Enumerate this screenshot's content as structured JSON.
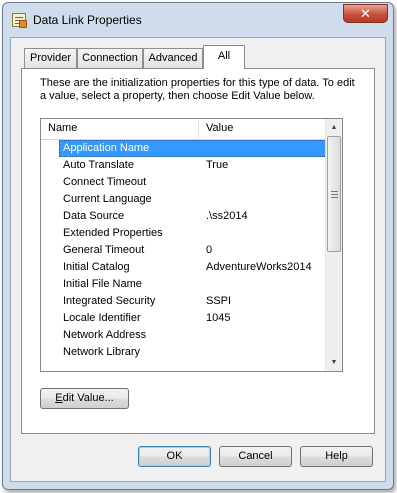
{
  "window": {
    "title": "Data Link Properties",
    "close_symbol": "✕"
  },
  "tabs": [
    {
      "label": "Provider",
      "active": false
    },
    {
      "label": "Connection",
      "active": false
    },
    {
      "label": "Advanced",
      "active": false
    },
    {
      "label": "All",
      "active": true
    }
  ],
  "description": "These are the initialization properties for this type of data. To edit a value, select a property, then choose Edit Value below.",
  "list": {
    "columns": {
      "name": "Name",
      "value": "Value"
    },
    "rows": [
      {
        "name": "Application Name",
        "value": "",
        "selected": true
      },
      {
        "name": "Auto Translate",
        "value": "True"
      },
      {
        "name": "Connect Timeout",
        "value": ""
      },
      {
        "name": "Current Language",
        "value": ""
      },
      {
        "name": "Data Source",
        "value": ".\\ss2014"
      },
      {
        "name": "Extended Properties",
        "value": ""
      },
      {
        "name": "General Timeout",
        "value": "0"
      },
      {
        "name": "Initial Catalog",
        "value": "AdventureWorks2014"
      },
      {
        "name": "Initial File Name",
        "value": ""
      },
      {
        "name": "Integrated Security",
        "value": "SSPI"
      },
      {
        "name": "Locale Identifier",
        "value": "1045"
      },
      {
        "name": "Network Address",
        "value": ""
      },
      {
        "name": "Network Library",
        "value": ""
      }
    ]
  },
  "buttons": {
    "edit_value_mnemonic": "E",
    "edit_value_rest": "dit Value...",
    "ok": "OK",
    "cancel": "Cancel",
    "help": "Help"
  },
  "colors": {
    "selection": "#3399ff",
    "dialog_bg": "#f0f0f0",
    "frame": "#cfdcec"
  },
  "icons": {
    "app": "data-link-icon",
    "close": "close-icon",
    "scroll_up": "scroll-up-arrow-icon",
    "scroll_down": "scroll-down-arrow-icon"
  }
}
